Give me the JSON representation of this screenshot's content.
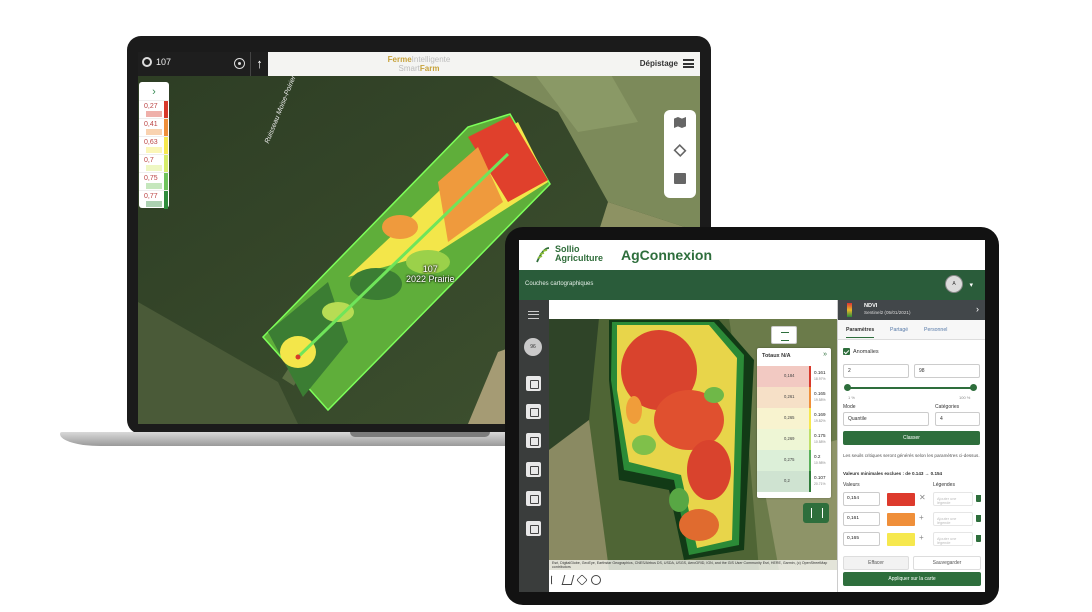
{
  "laptop": {
    "field_number": "107",
    "logo_line1_a": "Ferme",
    "logo_line1_b": "Intelligente",
    "logo_line2_a": "Smart",
    "logo_line2_b": "Farm",
    "mode_label": "Dépistage",
    "legend_values": [
      "0,27",
      "0,41",
      "0,63",
      "0,7",
      "0,75",
      "0,77"
    ],
    "legend_colors": [
      "#d8392b",
      "#ef8f3a",
      "#f6e84e",
      "#d5ec6a",
      "#6fc35b",
      "#2f8c3d"
    ],
    "stream_label": "Ruisseau Moise-Poirier",
    "field_label_line1": "107",
    "field_label_line2": "2022 Prairie"
  },
  "tablet": {
    "brand_sollio_1": "Sollio",
    "brand_sollio_2": "Agriculture",
    "brand_app": "AgConnexion",
    "breadcrumb": "Couches cartographiques",
    "user_initials": "A",
    "side_user": "96",
    "totaux": {
      "title": "Totaux N/A",
      "rows": [
        {
          "label": "0,184",
          "value": "0.161",
          "pct": "18.97%",
          "color": "#f2c9c2",
          "bar": "#d8392b"
        },
        {
          "label": "0,261",
          "value": "0.165",
          "pct": "19.58%",
          "color": "#f6e0c7",
          "bar": "#ef8f3a"
        },
        {
          "label": "0,265",
          "value": "0.169",
          "pct": "19.82%",
          "color": "#f8f3cf",
          "bar": "#f6e84e"
        },
        {
          "label": "0,269",
          "value": "0.175",
          "pct": "10.58%",
          "color": "#eef6d5",
          "bar": "#bfe06a"
        },
        {
          "label": "0,275",
          "value": "0.2",
          "pct": "10.98%",
          "color": "#dcefd8",
          "bar": "#59b05a"
        },
        {
          "label": "0,2",
          "value": "0.107",
          "pct": "20.71%",
          "color": "#cfe3d1",
          "bar": "#2f7d3a"
        }
      ]
    },
    "panel": {
      "layer": "NDVI",
      "source": "Sentinel2 (05/01/2021)",
      "tabs": [
        "Paramètres",
        "Partagé",
        "Personnel"
      ],
      "anomalies": "Anomalies",
      "min_value": "2",
      "max_value": "98",
      "slider_min": "1 %",
      "slider_max": "100 %",
      "mode_label": "Mode",
      "mode_value": "Quantile",
      "categories_label": "Catégories",
      "categories_value": "4",
      "classify_button": "Classer",
      "note": "Les seuils critiques seront générés selon les paramètres ci-dessus.",
      "excluded_label": "Valeurs minimales exclues : de",
      "excluded_from": "0.143",
      "excluded_to": "0.154",
      "values_label": "Valeurs",
      "legends_label": "Légendes",
      "value_rows": [
        {
          "value": "0,154",
          "color": "#dd3a2c",
          "icon": "✕"
        },
        {
          "value": "0,161",
          "color": "#ef8f3a",
          "icon": "+"
        },
        {
          "value": "0,165",
          "color": "#f6e84e",
          "icon": "+"
        }
      ],
      "legend_placeholder": "Ajouter une légende",
      "clear_button": "Effacer",
      "save_button": "Sauvegarder",
      "apply_button": "Appliquer sur la carte"
    },
    "attribution": "Esri, DigitalGlobe, GeoEye, Earthstar Geographics, CNES/Airbus DS, USDA, USGS, AeroGRID, IGN, and the GIS User Community Esri, HERE, Garmin, (c) OpenStreetMap contributors"
  }
}
